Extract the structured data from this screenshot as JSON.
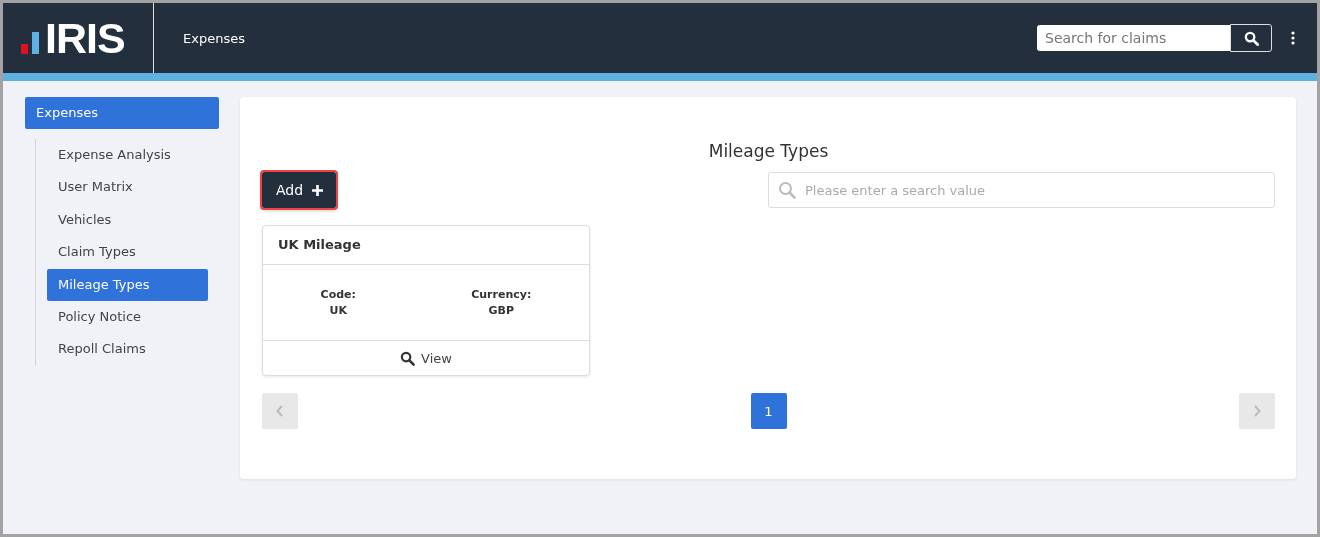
{
  "header": {
    "logo": "IRIS",
    "section": "Expenses",
    "search": {
      "placeholder": "Search for claims"
    }
  },
  "sidebar": {
    "group": {
      "label": "Expenses",
      "selected": true
    },
    "items": [
      {
        "label": "Expense Analysis",
        "selected": false
      },
      {
        "label": "User Matrix",
        "selected": false
      },
      {
        "label": "Vehicles",
        "selected": false
      },
      {
        "label": "Claim Types",
        "selected": false
      },
      {
        "label": "Mileage Types",
        "selected": true
      },
      {
        "label": "Policy Notice",
        "selected": false
      },
      {
        "label": "Repoll Claims",
        "selected": false
      }
    ]
  },
  "main": {
    "title": "Mileage Types",
    "add_button": {
      "label": "Add",
      "highlighted": true
    },
    "search": {
      "placeholder": "Please enter a search value"
    },
    "cards": [
      {
        "title": "UK Mileage",
        "fields": [
          {
            "label": "Code:",
            "value": "UK"
          },
          {
            "label": "Currency:",
            "value": "GBP"
          }
        ],
        "action": "View"
      }
    ],
    "pagination": {
      "pages": [
        {
          "label": "1",
          "selected": true
        }
      ],
      "prev_disabled": true,
      "next_disabled": true
    }
  }
}
